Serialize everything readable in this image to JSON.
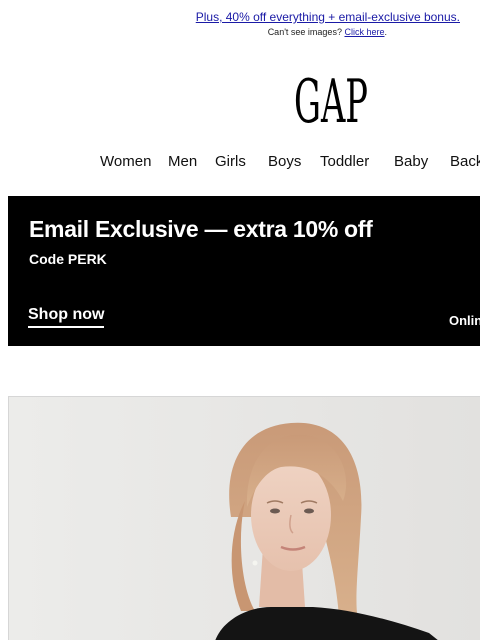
{
  "preheader": {
    "promo_link": "Plus, 40% off everything + email-exclusive bonus.",
    "images_note": "Can't see images?",
    "images_link": "Click here",
    "images_note_end": "."
  },
  "brand": {
    "logo_text": "GAP"
  },
  "nav": {
    "items": [
      {
        "label": "Women"
      },
      {
        "label": "Men"
      },
      {
        "label": "Girls"
      },
      {
        "label": "Boys"
      },
      {
        "label": "Toddler"
      },
      {
        "label": "Baby"
      },
      {
        "label": "Back"
      }
    ]
  },
  "banner": {
    "title": "Email Exclusive — extra 10% off",
    "code": "Code PERK",
    "cta": "Shop now",
    "side_text": "Onlin"
  },
  "hero": {
    "icon": "model-photo"
  },
  "colors": {
    "link": "#1a1aa6",
    "banner_bg": "#000000",
    "banner_text": "#ffffff",
    "hero_bg": "#e9e8e6"
  }
}
